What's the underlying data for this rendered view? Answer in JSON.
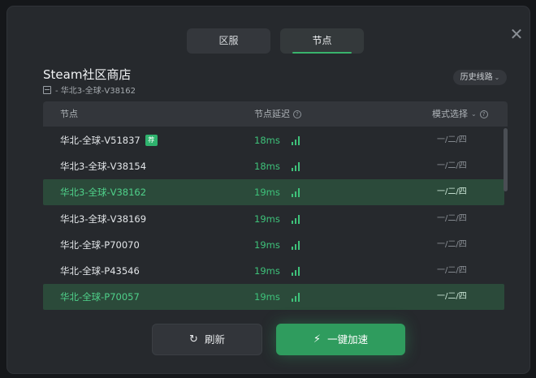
{
  "tabs": [
    {
      "label": "区服"
    },
    {
      "label": "节点"
    }
  ],
  "close_glyph": "✕",
  "game": {
    "title": "Steam社区商店",
    "current_node": "- 华北3-全球-V38162"
  },
  "history_button": {
    "label": "历史线路",
    "chevron": "⌄"
  },
  "table": {
    "headers": {
      "node": "节点",
      "latency": "节点延迟",
      "mode": "模式选择"
    },
    "help_glyph": "?",
    "sort_glyph": "⌄",
    "rows": [
      {
        "name": "华北-全球-V51837",
        "badge": "荐",
        "latency": "18ms",
        "mode": "一/二/四",
        "selected": false
      },
      {
        "name": "华北3-全球-V38154",
        "badge": "",
        "latency": "18ms",
        "mode": "一/二/四",
        "selected": false
      },
      {
        "name": "华北3-全球-V38162",
        "badge": "",
        "latency": "19ms",
        "mode": "一/二/四",
        "selected": true
      },
      {
        "name": "华北3-全球-V38169",
        "badge": "",
        "latency": "19ms",
        "mode": "一/二/四",
        "selected": false
      },
      {
        "name": "华北-全球-P70070",
        "badge": "",
        "latency": "19ms",
        "mode": "一/二/四",
        "selected": false
      },
      {
        "name": "华北-全球-P43546",
        "badge": "",
        "latency": "19ms",
        "mode": "一/二/四",
        "selected": false
      },
      {
        "name": "华北-全球-P70057",
        "badge": "",
        "latency": "19ms",
        "mode": "一/二/四",
        "selected": true
      }
    ]
  },
  "buttons": {
    "refresh": {
      "label": "刷新",
      "icon": "↻"
    },
    "accelerate": {
      "label": "一键加速",
      "icon": "⚡"
    }
  },
  "colors": {
    "accent": "#2f9c5e",
    "latency_good": "#3ec27a",
    "selected_row": "#2b4a3a"
  }
}
